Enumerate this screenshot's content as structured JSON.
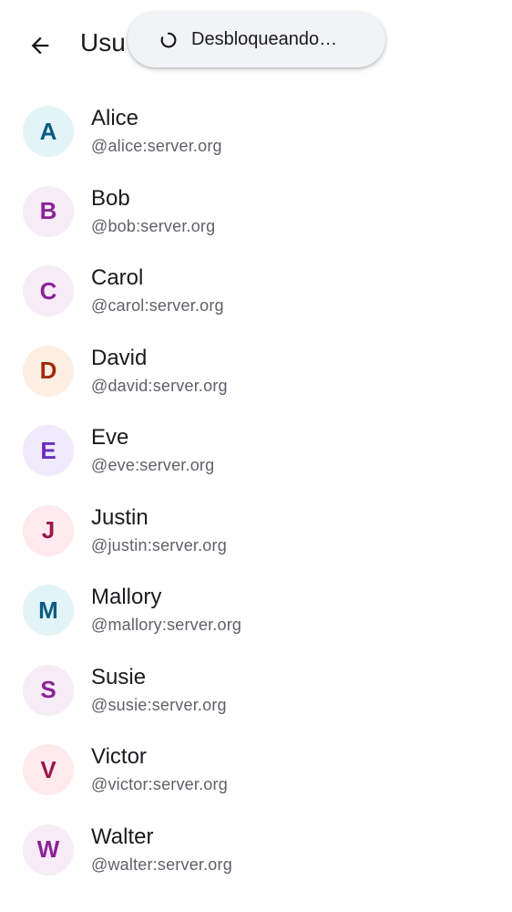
{
  "header": {
    "title": "Usu",
    "back_icon": "arrow-back-icon"
  },
  "toast": {
    "text": "Desbloqueando…",
    "icon": "loading-spinner-icon"
  },
  "users": [
    {
      "initial": "A",
      "name": "Alice",
      "handle": "@alice:server.org",
      "bg": "#e2f4f8",
      "fg": "#0b5a83"
    },
    {
      "initial": "B",
      "name": "Bob",
      "handle": "@bob:server.org",
      "bg": "#f8ebf8",
      "fg": "#8a2396"
    },
    {
      "initial": "C",
      "name": "Carol",
      "handle": "@carol:server.org",
      "bg": "#f8ebf8",
      "fg": "#8a2396"
    },
    {
      "initial": "D",
      "name": "David",
      "handle": "@david:server.org",
      "bg": "#fdeee3",
      "fg": "#a12a0a"
    },
    {
      "initial": "E",
      "name": "Eve",
      "handle": "@eve:server.org",
      "bg": "#efeafc",
      "fg": "#6a2bc2"
    },
    {
      "initial": "J",
      "name": "Justin",
      "handle": "@justin:server.org",
      "bg": "#fde9ee",
      "fg": "#9c1747"
    },
    {
      "initial": "M",
      "name": "Mallory",
      "handle": "@mallory:server.org",
      "bg": "#e2f4f8",
      "fg": "#0b5a83"
    },
    {
      "initial": "S",
      "name": "Susie",
      "handle": "@susie:server.org",
      "bg": "#f8ebf8",
      "fg": "#8a2396"
    },
    {
      "initial": "V",
      "name": "Victor",
      "handle": "@victor:server.org",
      "bg": "#fde9ee",
      "fg": "#9c1747"
    },
    {
      "initial": "W",
      "name": "Walter",
      "handle": "@walter:server.org",
      "bg": "#f8ebf8",
      "fg": "#8a2396"
    }
  ]
}
